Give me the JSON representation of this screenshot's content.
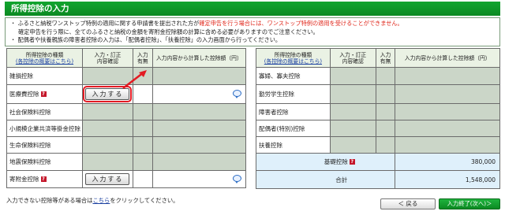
{
  "page": {
    "title": "所得控除の入力"
  },
  "notice": {
    "line1_prefix": "・ ふるさと納税ワンストップ特例の適用に関する申請書を提出された方が",
    "line1_red": "確定申告を行う場合には、ワンストップ特例の適用を受けることができません。",
    "line2": "確定申告を行う際に、全てのふるさと納税の金額を寄附金控除額の計算に含める必要がありますのでご注意ください。",
    "line3": "・ 配偶者や扶養親族の障害者控除の入力は、「配偶者控除」、「扶養控除」の入力画面から行ってください。"
  },
  "left_table": {
    "header_type_line1": "所得控除の種類",
    "header_type_link": "(各控除の概要はこちら)",
    "header_input": "入力・訂正\n内容確認",
    "header_has": "入力\n有無",
    "header_amount": "入力内容から計算した控除額（円）",
    "rows": [
      {
        "label": "雑損控除",
        "has_q": false,
        "button": ""
      },
      {
        "label": "医療費控除",
        "has_q": true,
        "button": "入力する"
      },
      {
        "label": "社会保険料控除",
        "has_q": false,
        "button": ""
      },
      {
        "label": "小規模企業共済等掛金控除",
        "has_q": false,
        "button": ""
      },
      {
        "label": "生命保険料控除",
        "has_q": false,
        "button": ""
      },
      {
        "label": "地震保険料控除",
        "has_q": false,
        "button": ""
      },
      {
        "label": "寄附金控除",
        "has_q": true,
        "button": "入力する"
      }
    ],
    "q_mark": "?"
  },
  "right_table": {
    "header_type_line1": "所得控除の種類",
    "header_type_link": "(各控除の概要はこちら)",
    "header_input": "入力・訂正\n内容確認",
    "header_has": "入力\n有無",
    "header_amount": "入力内容から計算した控除額（円）",
    "rows": [
      {
        "label": "寡婦、寡夫控除"
      },
      {
        "label": "勤労学生控除"
      },
      {
        "label": "障害者控除"
      },
      {
        "label": "配偶者(特別)控除"
      },
      {
        "label": "扶養控除"
      }
    ],
    "basic_label": "基礎控除",
    "basic_value": "380,000",
    "total_label": "合計",
    "total_value": "1,548,000"
  },
  "footer": {
    "text_prefix": "入力できない控除等がある場合は",
    "link": "こちら",
    "text_suffix": "をクリックしてください。",
    "back_label": "＜ 戻る",
    "next_label": "入力終了(次へ)＞"
  },
  "colors": {
    "header_green": "#0b8a22",
    "accent_red": "#e31b23",
    "total_blue": "#dff0fb"
  }
}
